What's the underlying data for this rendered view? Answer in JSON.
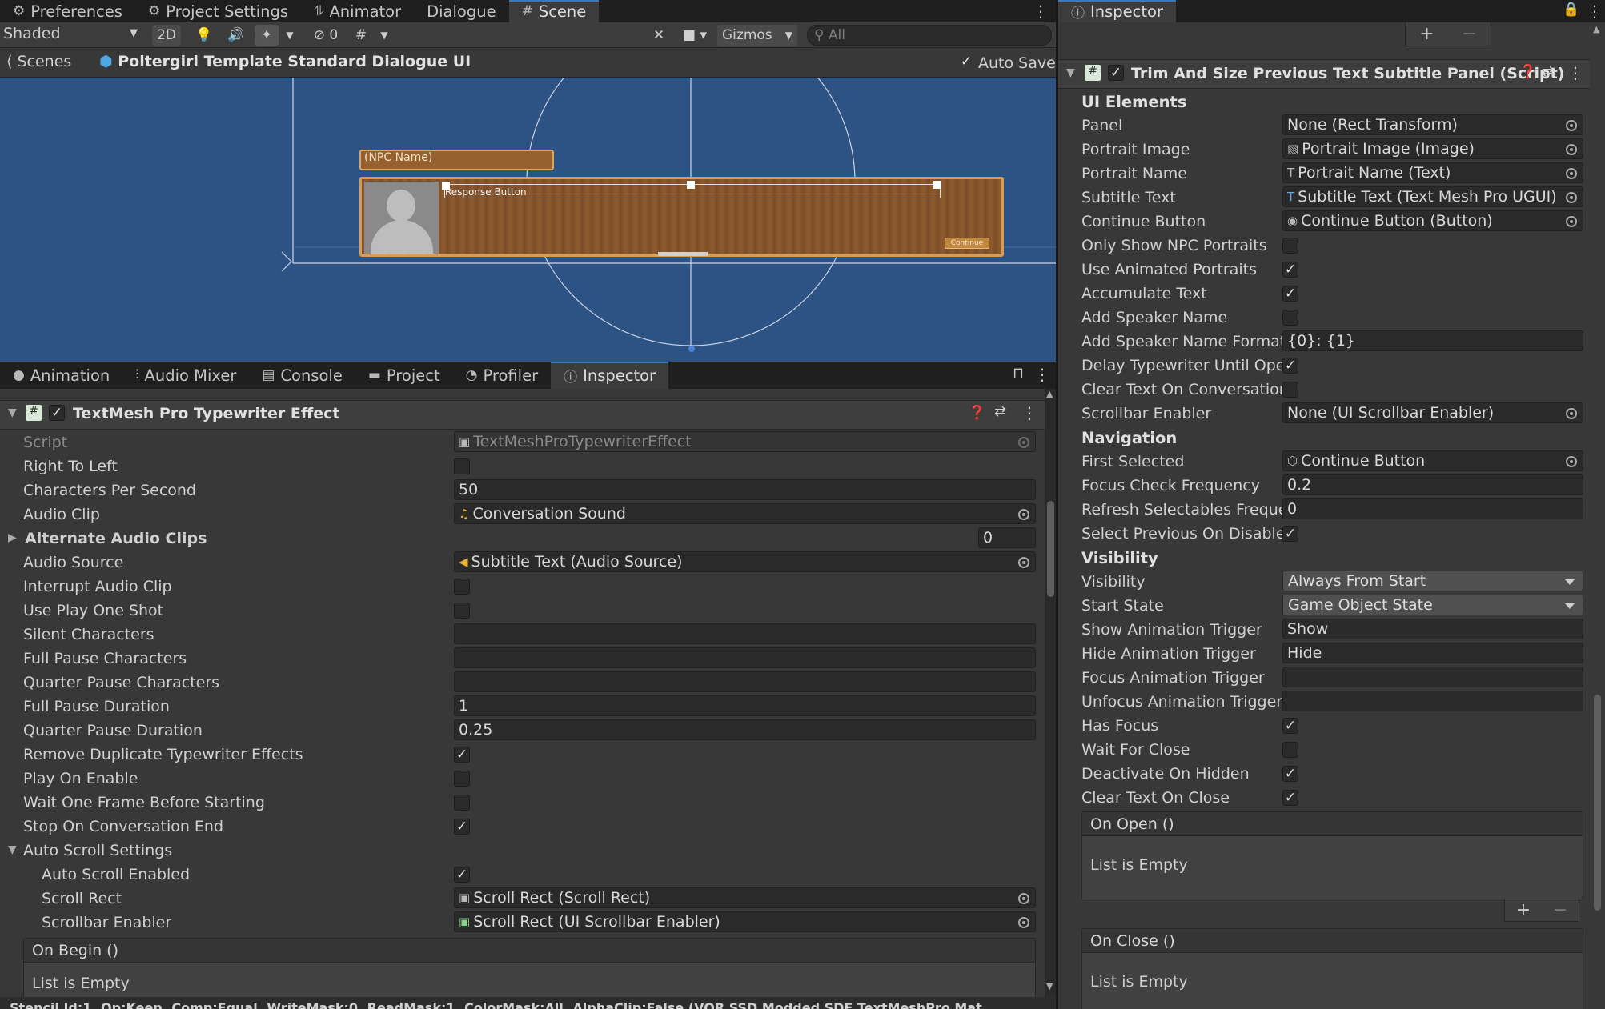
{
  "top_tabs": [
    {
      "label": "Preferences",
      "icon": "gear-icon"
    },
    {
      "label": "Project Settings",
      "icon": "gear-icon"
    },
    {
      "label": "Animator",
      "icon": "animator-icon"
    },
    {
      "label": "Dialogue",
      "icon": ""
    },
    {
      "label": "Scene",
      "icon": "grid-icon"
    }
  ],
  "scene_toolbar": {
    "shading": "Shaded",
    "mode_2d": "2D",
    "hidden_count": "0",
    "gizmos": "Gizmos",
    "search_placeholder": "All"
  },
  "scene_bar": {
    "scenes_label": "Scenes",
    "prefab_name": "Poltergirl Template Standard Dialogue UI",
    "auto_save": "Auto Save"
  },
  "viewport": {
    "npc_name": "(NPC Name)",
    "response_button": "Response Button",
    "continue": "Continue"
  },
  "bottom_tabs": [
    {
      "label": "Animation",
      "icon": "animation-icon"
    },
    {
      "label": "Audio Mixer",
      "icon": "mixer-icon"
    },
    {
      "label": "Console",
      "icon": "console-icon"
    },
    {
      "label": "Project",
      "icon": "folder-icon"
    },
    {
      "label": "Profiler",
      "icon": "profiler-icon"
    },
    {
      "label": "Inspector",
      "icon": "info-icon"
    }
  ],
  "left_inspector": {
    "component_title": "TextMesh Pro Typewriter Effect",
    "script_label": "Script",
    "script_value": "TextMeshProTypewriterEffect",
    "right_to_left": "Right To Left",
    "cps_label": "Characters Per Second",
    "cps_value": "50",
    "audio_clip_label": "Audio Clip",
    "audio_clip_value": "Conversation Sound",
    "alt_clips_label": "Alternate Audio Clips",
    "alt_clips_count": "0",
    "audio_source_label": "Audio Source",
    "audio_source_value": "Subtitle Text (Audio Source)",
    "interrupt_label": "Interrupt Audio Clip",
    "play_one_shot_label": "Use Play One Shot",
    "silent_label": "Silent Characters",
    "full_pause_chars_label": "Full Pause Characters",
    "quarter_pause_chars_label": "Quarter Pause Characters",
    "full_pause_dur_label": "Full Pause Duration",
    "full_pause_dur_value": "1",
    "quarter_pause_dur_label": "Quarter Pause Duration",
    "quarter_pause_dur_value": "0.25",
    "remove_dup_label": "Remove Duplicate Typewriter Effects",
    "play_on_enable_label": "Play On Enable",
    "wait_one_frame_label": "Wait One Frame Before Starting",
    "stop_on_end_label": "Stop On Conversation End",
    "auto_scroll_label": "Auto Scroll Settings",
    "auto_scroll_enabled_label": "Auto Scroll Enabled",
    "scroll_rect_label": "Scroll Rect",
    "scroll_rect_value": "Scroll Rect (Scroll Rect)",
    "scrollbar_enabler_label": "Scrollbar Enabler",
    "scrollbar_enabler_value": "Scroll Rect (UI Scrollbar Enabler)",
    "on_begin": "On Begin ()",
    "list_empty": "List is Empty",
    "status_line": "Stencil Id:1, Op:Keep, Comp:Equal, WriteMask:0, ReadMask:1, ColorMask:All, AlphaClip:False (VOR SSD Modded SDF TextMeshPro Mat"
  },
  "right_panel": {
    "tab": "Inspector",
    "component_title": "Trim And Size Previous Text Subtitle Panel (Script)",
    "ui_elements_header": "UI Elements",
    "panel_label": "Panel",
    "panel_value": "None (Rect Transform)",
    "portrait_image_label": "Portrait Image",
    "portrait_image_value": "Portrait Image (Image)",
    "portrait_name_label": "Portrait Name",
    "portrait_name_value": "Portrait Name (Text)",
    "subtitle_text_label": "Subtitle Text",
    "subtitle_text_value": "Subtitle Text (Text Mesh Pro UGUI)",
    "continue_button_label": "Continue Button",
    "continue_button_value": "Continue Button (Button)",
    "only_npc_label": "Only Show NPC Portraits",
    "use_animated_label": "Use Animated Portraits",
    "accumulate_label": "Accumulate Text",
    "add_speaker_label": "Add Speaker Name",
    "speaker_format_label": "Add Speaker Name Format",
    "speaker_format_value": "{0}: {1}",
    "delay_typewriter_label": "Delay Typewriter Until Open",
    "clear_on_conv_label": "Clear Text On Conversation",
    "scrollbar_enabler_label": "Scrollbar Enabler",
    "scrollbar_enabler_value": "None (UI Scrollbar Enabler)",
    "navigation_header": "Navigation",
    "first_selected_label": "First Selected",
    "first_selected_value": "Continue Button",
    "focus_check_label": "Focus Check Frequency",
    "focus_check_value": "0.2",
    "refresh_label": "Refresh Selectables Frequer",
    "refresh_value": "0",
    "select_prev_label": "Select Previous On Disable",
    "visibility_header": "Visibility",
    "visibility_label": "Visibility",
    "visibility_value": "Always From Start",
    "start_state_label": "Start State",
    "start_state_value": "Game Object State",
    "show_trigger_label": "Show Animation Trigger",
    "show_trigger_value": "Show",
    "hide_trigger_label": "Hide Animation Trigger",
    "hide_trigger_value": "Hide",
    "focus_trigger_label": "Focus Animation Trigger",
    "unfocus_trigger_label": "Unfocus Animation Trigger",
    "has_focus_label": "Has Focus",
    "wait_close_label": "Wait For Close",
    "deactivate_label": "Deactivate On Hidden",
    "clear_close_label": "Clear Text On Close",
    "on_open": "On Open ()",
    "on_close": "On Close ()",
    "list_empty": "List is Empty"
  },
  "colors": {
    "viewport_bg": "#2d5284",
    "panel_bg": "#383838",
    "wood": "#8a5a2e",
    "accent": "#3a79bb"
  }
}
